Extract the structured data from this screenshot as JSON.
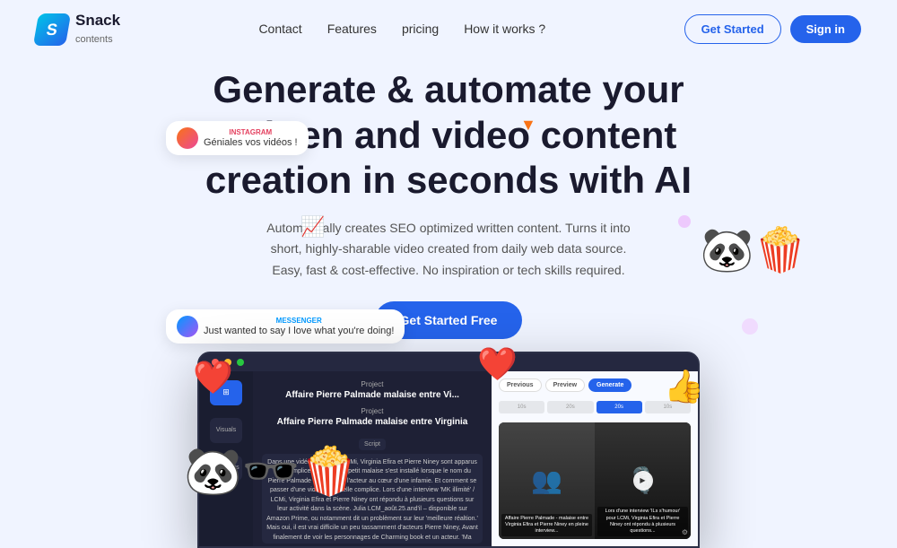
{
  "nav": {
    "logo_text": "Snack",
    "logo_sub": "contents",
    "links": [
      "Contact",
      "Features",
      "pricing",
      "How it works ?"
    ],
    "btn_started": "Get Started",
    "btn_signin": "Sign in"
  },
  "hero": {
    "title": "Generate & automate your written and video content creation in seconds with AI",
    "subtitle": "Automatically creates SEO optimized written content. Turns it into short, highly-sharable video created from daily web data source. Easy, fast & cost-effective. No inspiration or tech skills required.",
    "cta": "Get Started Free"
  },
  "bubble_instagram": {
    "platform": "INSTAGRAM",
    "text": "Géniales vos vidéos !"
  },
  "bubble_messenger": {
    "platform": "MESSENGER",
    "text": "Just wanted to say I love what you're doing!"
  },
  "dashboard": {
    "project_label": "Project",
    "project_title": "Affaire Pierre Palmade malaise entre Vi...",
    "project_label2": "Project",
    "project_title2": "Affaire Pierre Palmade malaise entre Virginia",
    "script_label": "Script",
    "btn_previous": "Previous",
    "btn_preview": "Preview",
    "btn_generate": "Generate",
    "timeline": [
      "10s",
      "20s",
      "20s",
      "10s"
    ],
    "body_text": "Dans une vidéo publié par LCMi, Virginia Efira et Pierre Niney sont apparus très complices. Et c'est un petit malaise s'est installé lorsque le nom du Pierre Palmade a été cité et l'acteur au cœur d'une infamie.\n\nEt comment se passer d'une vidéo d'une telle complice. Lors d'une interview 'MK illimité' / LCMi, Virginia Efira et Pierre Niney ont répondu à plusieurs questions sur leur activité dans la scène. Julia LCM_août.25.and'il – disponible sur Amazon Prime, ou notamment dit un problèment sur leur 'meilleure réaltion.' Mais oui, il est vrai difficile un peu tassamment d'acteurs Pierre Niney, Avant finalement de voir les personnages de Charming book et un acteur. 'Ma meilleure réaltion, c'est Pierre Palmade.'",
    "caption_left": "Affaire Pierre Palmade - malaise entre Virginia Efira et Pierre Niney en pleine interview...",
    "caption_right": "Lors d'une interview 'ILs s'humour' pour LCMi, Virginia Efira et Pierre Niney ont répondu à plusieurs questions..."
  }
}
